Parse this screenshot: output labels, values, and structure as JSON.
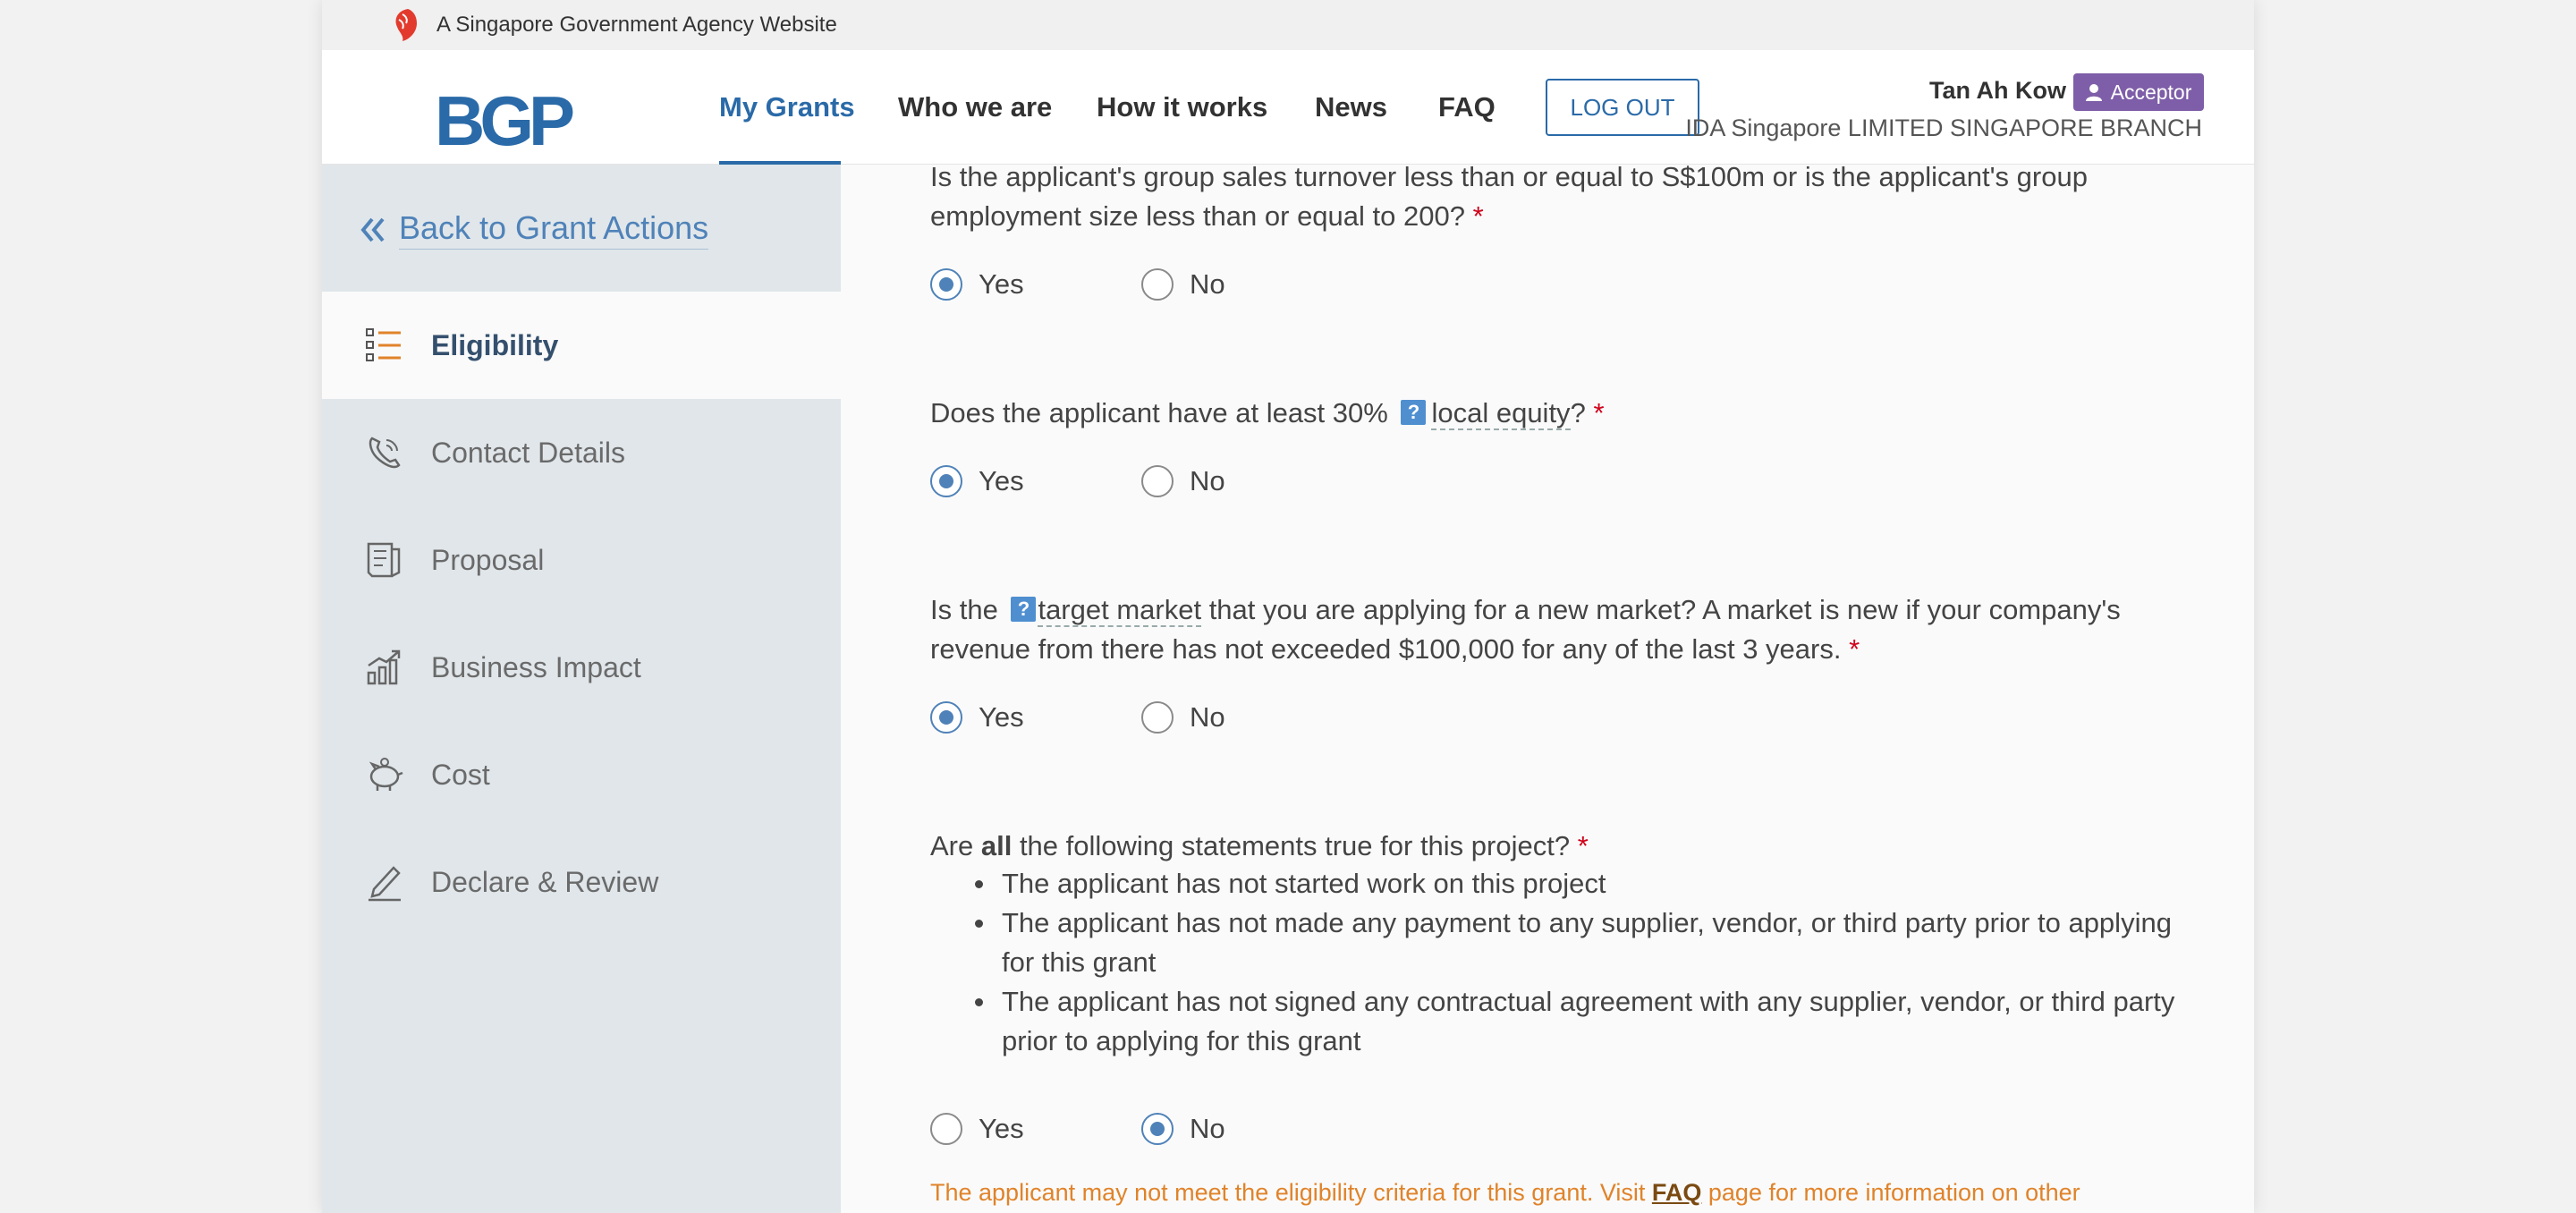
{
  "masthead": {
    "text": "A Singapore Government Agency Website"
  },
  "header": {
    "logo": "BGP",
    "nav": [
      "My Grants",
      "Who we are",
      "How it works",
      "News",
      "FAQ"
    ],
    "logout": "LOG OUT",
    "user_name": "Tan Ah Kow",
    "role": "Acceptor",
    "company": "IDA Singapore LIMITED SINGAPORE BRANCH"
  },
  "sidebar": {
    "back": "Back to Grant Actions",
    "items": [
      {
        "label": "Eligibility",
        "icon": "list-icon"
      },
      {
        "label": "Contact Details",
        "icon": "phone-icon"
      },
      {
        "label": "Proposal",
        "icon": "document-icon"
      },
      {
        "label": "Business Impact",
        "icon": "growth-chart-icon"
      },
      {
        "label": "Cost",
        "icon": "piggy-bank-icon"
      },
      {
        "label": "Declare & Review",
        "icon": "pen-sign-icon"
      }
    ]
  },
  "questions": {
    "q1": {
      "text": "Is the applicant's group sales turnover less than or equal to S$100m or is the applicant's group employment size less than or equal to 200?",
      "selected": "Yes"
    },
    "q2": {
      "text_before": "Does the applicant have at least 30%",
      "term": "local equity",
      "text_after": "?",
      "selected": "Yes"
    },
    "q3": {
      "text_before": "Is the",
      "term": "target market",
      "text_after": " that you are applying for a new market? A market is new if your company's revenue from there has not exceeded $100,000 for any of the last 3 years.",
      "selected": "Yes"
    },
    "q4": {
      "text_before": "Are ",
      "bold": "all",
      "text_after": " the following statements true for this project?",
      "bullets": [
        "The applicant has not started work on this project",
        "The applicant has not made any payment to any supplier, vendor, or third party prior to applying for this grant",
        "The applicant has not signed any contractual agreement with any supplier, vendor, or third party prior to applying for this grant"
      ],
      "selected": "No"
    },
    "required_mark": "*",
    "yes": "Yes",
    "no": "No",
    "tip_mark": "?"
  },
  "warning": {
    "before": "The applicant may not meet the eligibility criteria for this grant. Visit ",
    "link": "FAQ",
    "after": " page for more information on other"
  },
  "colors": {
    "primary": "#2a6aa8",
    "sidebar_bg": "#e0e6ea",
    "badge": "#7e5ea8",
    "warning": "#e0832a",
    "required": "#d0021b"
  }
}
